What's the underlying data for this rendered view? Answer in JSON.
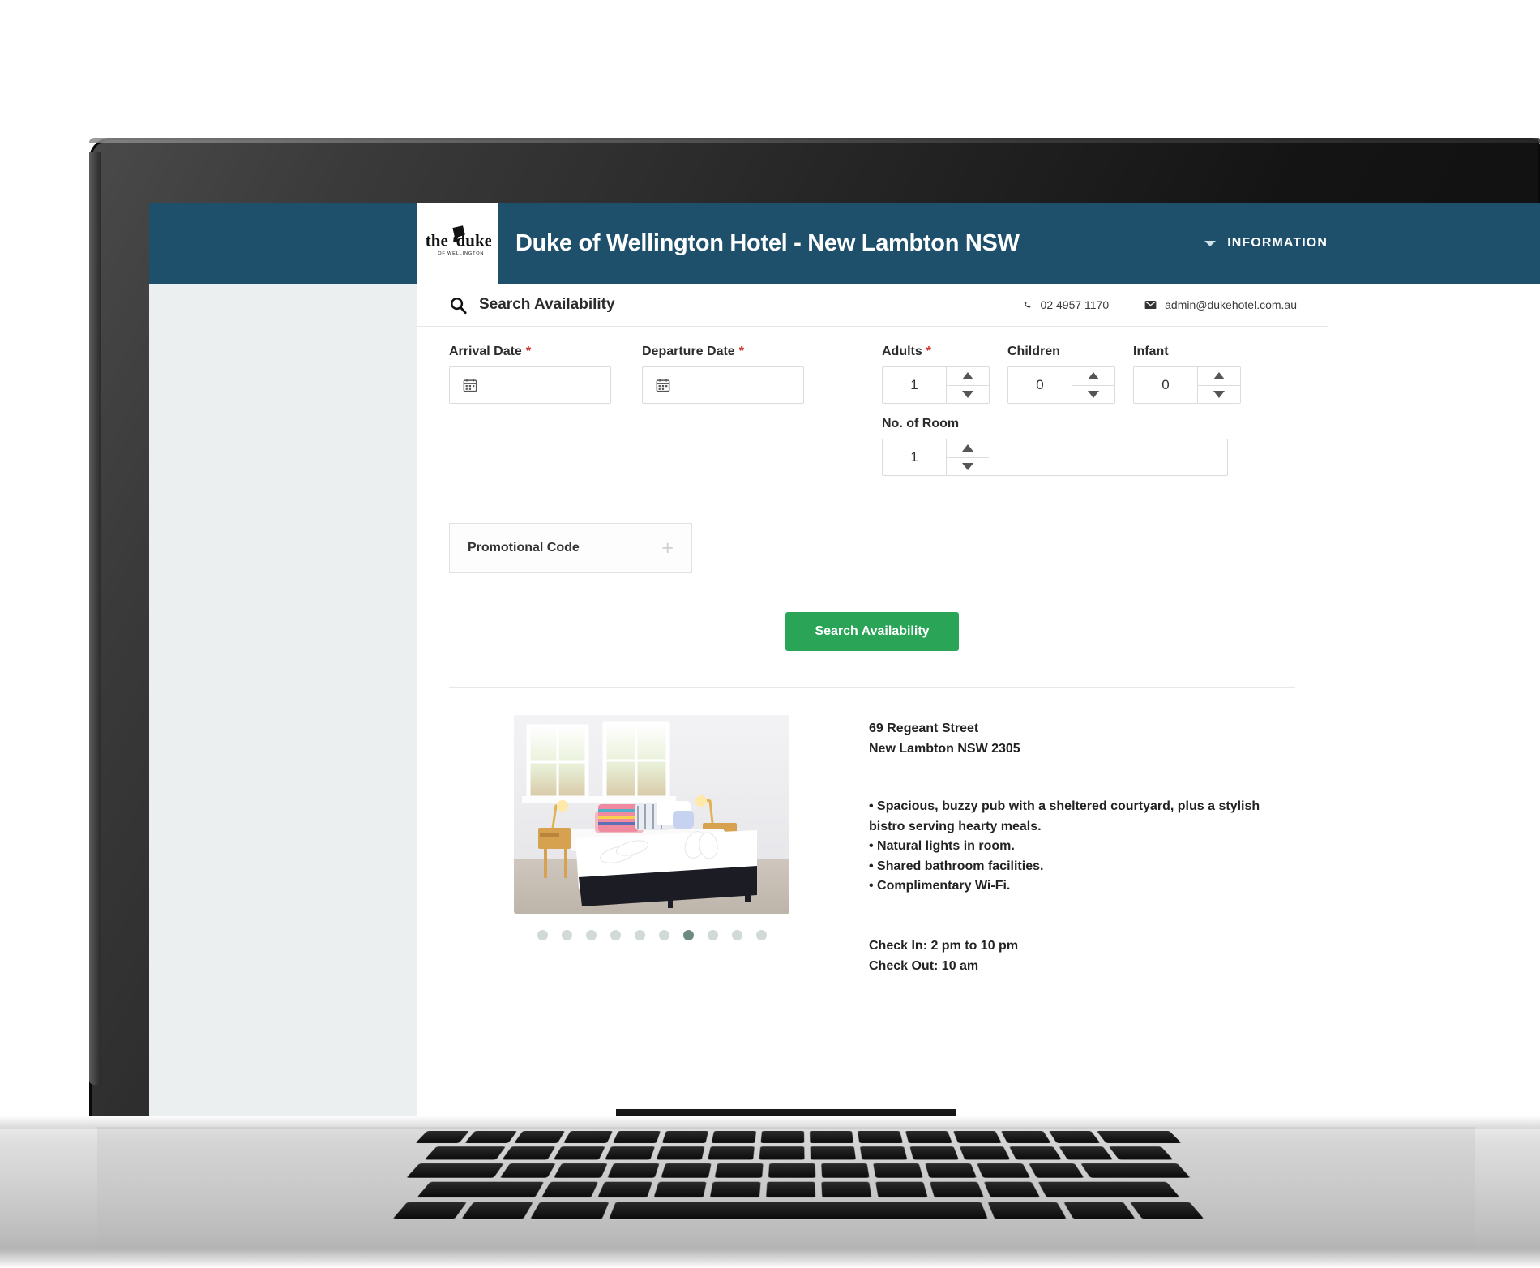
{
  "header": {
    "logo_alt": "the duke",
    "logo_sub": "OF WELLINGTON",
    "site_title": "Duke of Wellington Hotel - New Lambton NSW",
    "nav_item": "INFORMATION"
  },
  "search_bar": {
    "title": "Search Availability",
    "phone": "02 4957 1170",
    "email": "admin@dukehotel.com.au"
  },
  "form": {
    "arrival": {
      "label": "Arrival Date",
      "required": "*",
      "value": "",
      "placeholder": ""
    },
    "departure": {
      "label": "Departure Date",
      "required": "*",
      "value": "",
      "placeholder": ""
    },
    "adults": {
      "label": "Adults",
      "required": "*",
      "value": "1"
    },
    "children": {
      "label": "Children",
      "value": "0"
    },
    "infant": {
      "label": "Infant",
      "value": "0"
    },
    "rooms": {
      "label": "No. of Room",
      "value": "1"
    },
    "promo": {
      "label": "Promotional Code",
      "toggle": "+"
    },
    "submit_label": "Search Availability"
  },
  "property": {
    "address_line1": "69 Regeant Street",
    "address_line2": "New Lambton NSW 2305",
    "features": [
      "• Spacious, buzzy pub with a sheltered courtyard, plus a stylish bistro serving hearty meals.",
      "• Natural lights in room.",
      "• Shared bathroom facilities.",
      "• Complimentary Wi-Fi."
    ],
    "check_in": "Check In: 2 pm to 10 pm",
    "check_out": "Check Out: 10 am",
    "gallery": {
      "total_dots": 10,
      "active_index": 7,
      "photo_caption": "Hotel bedroom with double bed, two bedside lamps and windows"
    }
  },
  "colors": {
    "header_blue": "#1e4f6b",
    "cta_green": "#2aa457",
    "required_red": "#d0342c",
    "page_gutter": "#eceff0",
    "dot_inactive": "#d2dad8",
    "dot_active": "#6d8b83"
  }
}
